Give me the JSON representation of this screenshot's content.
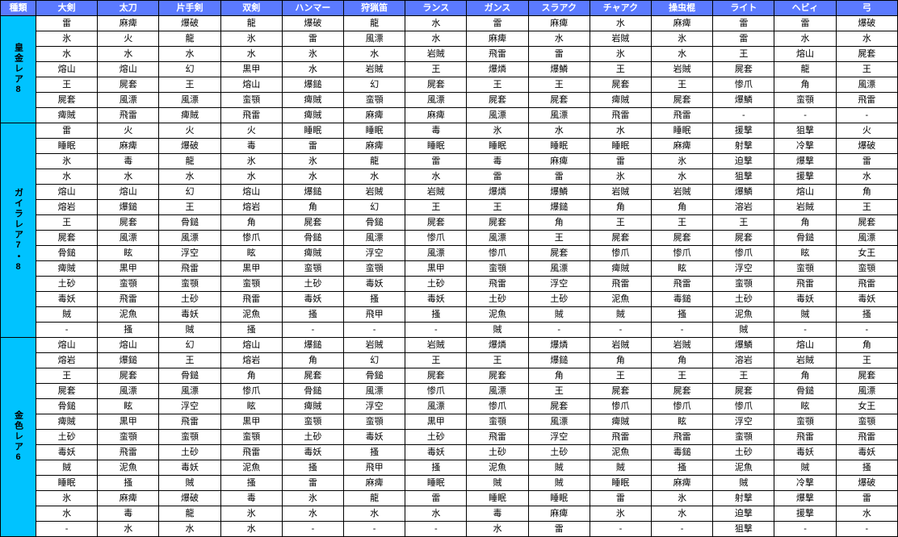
{
  "columns": [
    "種類",
    "大剣",
    "太刀",
    "片手剣",
    "双剣",
    "ハンマー",
    "狩猟笛",
    "ランス",
    "ガンス",
    "スラアク",
    "チャアク",
    "操虫棍",
    "ライト",
    "ヘビィ",
    "弓"
  ],
  "chart_data": {
    "type": "table",
    "columns": [
      "種類",
      "大剣",
      "太刀",
      "片手剣",
      "双剣",
      "ハンマー",
      "狩猟笛",
      "ランス",
      "ガンス",
      "スラアク",
      "チャアク",
      "操虫棍",
      "ライト",
      "ヘビィ",
      "弓"
    ],
    "groups": [
      {
        "name": "皇金レア8",
        "rows": [
          [
            "雷",
            "麻痺",
            "爆破",
            "龍",
            "爆破",
            "龍",
            "水",
            "雷",
            "麻痺",
            "水",
            "麻痺",
            "雷",
            "雷",
            "爆破"
          ],
          [
            "氷",
            "火",
            "龍",
            "氷",
            "雷",
            "風漂",
            "水",
            "麻痺",
            "水",
            "岩賊",
            "氷",
            "雷",
            "水",
            "水"
          ],
          [
            "水",
            "水",
            "水",
            "水",
            "氷",
            "水",
            "岩賊",
            "飛雷",
            "雷",
            "氷",
            "水",
            "王",
            "熔山",
            "屍套"
          ],
          [
            "熔山",
            "熔山",
            "幻",
            "黒甲",
            "水",
            "岩賊",
            "王",
            "爆燐",
            "爆鱗",
            "王",
            "岩賊",
            "屍套",
            "龍",
            "王"
          ],
          [
            "王",
            "屍套",
            "王",
            "熔山",
            "爆鎚",
            "幻",
            "屍套",
            "王",
            "王",
            "屍套",
            "王",
            "惨爪",
            "角",
            "風漂"
          ],
          [
            "屍套",
            "風漂",
            "風漂",
            "蛮顎",
            "痺賊",
            "蛮顎",
            "風漂",
            "屍套",
            "屍套",
            "痺賊",
            "屍套",
            "爆鱗",
            "蛮顎",
            "飛雷"
          ],
          [
            "痺賊",
            "飛雷",
            "痺賊",
            "飛雷",
            "痺賊",
            "麻痺",
            "麻痺",
            "風漂",
            "風漂",
            "飛雷",
            "飛雷",
            "-",
            "-",
            "-"
          ]
        ]
      },
      {
        "name": "ガイラレア7・8",
        "rows": [
          [
            "雷",
            "火",
            "火",
            "火",
            "睡眠",
            "睡眠",
            "毒",
            "氷",
            "水",
            "水",
            "睡眠",
            "援撃",
            "狙撃",
            "火"
          ],
          [
            "睡眠",
            "麻痺",
            "爆破",
            "毒",
            "雷",
            "麻痺",
            "睡眠",
            "睡眠",
            "睡眠",
            "睡眠",
            "麻痺",
            "射撃",
            "冷撃",
            "爆破"
          ],
          [
            "氷",
            "毒",
            "龍",
            "氷",
            "氷",
            "龍",
            "雷",
            "毒",
            "麻痺",
            "雷",
            "氷",
            "迫撃",
            "爆撃",
            "雷"
          ],
          [
            "水",
            "水",
            "水",
            "水",
            "水",
            "水",
            "水",
            "雷",
            "雷",
            "氷",
            "水",
            "狙撃",
            "援撃",
            "水"
          ],
          [
            "熔山",
            "熔山",
            "幻",
            "熔山",
            "爆鎚",
            "岩賊",
            "岩賊",
            "爆燐",
            "爆鱗",
            "岩賊",
            "岩賊",
            "爆鱗",
            "熔山",
            "角"
          ],
          [
            "熔岩",
            "爆鎚",
            "王",
            "熔岩",
            "角",
            "幻",
            "王",
            "王",
            "爆鎚",
            "角",
            "角",
            "溶岩",
            "岩賊",
            "王"
          ],
          [
            "王",
            "屍套",
            "骨鎚",
            "角",
            "屍套",
            "骨鎚",
            "屍套",
            "屍套",
            "角",
            "王",
            "王",
            "王",
            "角",
            "屍套"
          ],
          [
            "屍套",
            "風漂",
            "風漂",
            "惨爪",
            "骨鎚",
            "風漂",
            "惨爪",
            "風漂",
            "王",
            "屍套",
            "屍套",
            "屍套",
            "骨鎚",
            "風漂"
          ],
          [
            "骨鎚",
            "眩",
            "浮空",
            "眩",
            "痺賊",
            "浮空",
            "風漂",
            "惨爪",
            "屍套",
            "惨爪",
            "惨爪",
            "惨爪",
            "眩",
            "女王"
          ],
          [
            "痺賊",
            "黒甲",
            "飛雷",
            "黒甲",
            "蛮顎",
            "蛮顎",
            "黒甲",
            "蛮顎",
            "風漂",
            "痺賊",
            "眩",
            "浮空",
            "蛮顎",
            "蛮顎"
          ],
          [
            "土砂",
            "蛮顎",
            "蛮顎",
            "蛮顎",
            "土砂",
            "毒妖",
            "土砂",
            "飛雷",
            "浮空",
            "飛雷",
            "飛雷",
            "蛮顎",
            "飛雷",
            "飛雷"
          ],
          [
            "毒妖",
            "飛雷",
            "土砂",
            "飛雷",
            "毒妖",
            "搔",
            "毒妖",
            "土砂",
            "土砂",
            "泥魚",
            "毒鎚",
            "土砂",
            "毒妖",
            "毒妖"
          ],
          [
            "賊",
            "泥魚",
            "毒妖",
            "泥魚",
            "搔",
            "飛甲",
            "搔",
            "泥魚",
            "賊",
            "賊",
            "搔",
            "泥魚",
            "賊",
            "搔"
          ],
          [
            "-",
            "搔",
            "賊",
            "搔",
            "-",
            "-",
            "-",
            "賊",
            "-",
            "-",
            "-",
            "賊",
            "-",
            "-"
          ]
        ]
      },
      {
        "name": "金色レア6",
        "rows": [
          [
            "熔山",
            "熔山",
            "幻",
            "熔山",
            "爆鎚",
            "岩賊",
            "岩賊",
            "爆燐",
            "爆燐",
            "岩賊",
            "岩賊",
            "爆鱗",
            "熔山",
            "角"
          ],
          [
            "熔岩",
            "爆鎚",
            "王",
            "熔岩",
            "角",
            "幻",
            "王",
            "王",
            "爆鎚",
            "角",
            "角",
            "溶岩",
            "岩賊",
            "王"
          ],
          [
            "王",
            "屍套",
            "骨鎚",
            "角",
            "屍套",
            "骨鎚",
            "屍套",
            "屍套",
            "角",
            "王",
            "王",
            "王",
            "角",
            "屍套"
          ],
          [
            "屍套",
            "風漂",
            "風漂",
            "惨爪",
            "骨鎚",
            "風漂",
            "惨爪",
            "風漂",
            "王",
            "屍套",
            "屍套",
            "屍套",
            "骨鎚",
            "風漂"
          ],
          [
            "骨鎚",
            "眩",
            "浮空",
            "眩",
            "痺賊",
            "浮空",
            "風漂",
            "惨爪",
            "屍套",
            "惨爪",
            "惨爪",
            "惨爪",
            "眩",
            "女王"
          ],
          [
            "痺賊",
            "黒甲",
            "飛雷",
            "黒甲",
            "蛮顎",
            "蛮顎",
            "黒甲",
            "蛮顎",
            "風漂",
            "痺賊",
            "眩",
            "浮空",
            "蛮顎",
            "蛮顎"
          ],
          [
            "土砂",
            "蛮顎",
            "蛮顎",
            "蛮顎",
            "土砂",
            "毒妖",
            "土砂",
            "飛雷",
            "浮空",
            "飛雷",
            "飛雷",
            "蛮顎",
            "飛雷",
            "飛雷"
          ],
          [
            "毒妖",
            "飛雷",
            "土砂",
            "飛雷",
            "毒妖",
            "搔",
            "毒妖",
            "土砂",
            "土砂",
            "泥魚",
            "毒鎚",
            "土砂",
            "毒妖",
            "毒妖"
          ],
          [
            "賊",
            "泥魚",
            "毒妖",
            "泥魚",
            "搔",
            "飛甲",
            "搔",
            "泥魚",
            "賊",
            "賊",
            "搔",
            "泥魚",
            "賊",
            "搔"
          ],
          [
            "睡眠",
            "搔",
            "賊",
            "搔",
            "雷",
            "麻痺",
            "睡眠",
            "賊",
            "賊",
            "睡眠",
            "麻痺",
            "賊",
            "冷撃",
            "爆破"
          ],
          [
            "氷",
            "麻痺",
            "爆破",
            "毒",
            "氷",
            "龍",
            "雷",
            "睡眠",
            "睡眠",
            "雷",
            "氷",
            "射撃",
            "爆撃",
            "雷"
          ],
          [
            "水",
            "毒",
            "龍",
            "氷",
            "水",
            "水",
            "水",
            "毒",
            "麻痺",
            "氷",
            "水",
            "迫撃",
            "援撃",
            "水"
          ],
          [
            "-",
            "水",
            "水",
            "水",
            "-",
            "-",
            "-",
            "水",
            "雷",
            "-",
            "-",
            "狙撃",
            "-",
            "-"
          ]
        ]
      }
    ]
  }
}
